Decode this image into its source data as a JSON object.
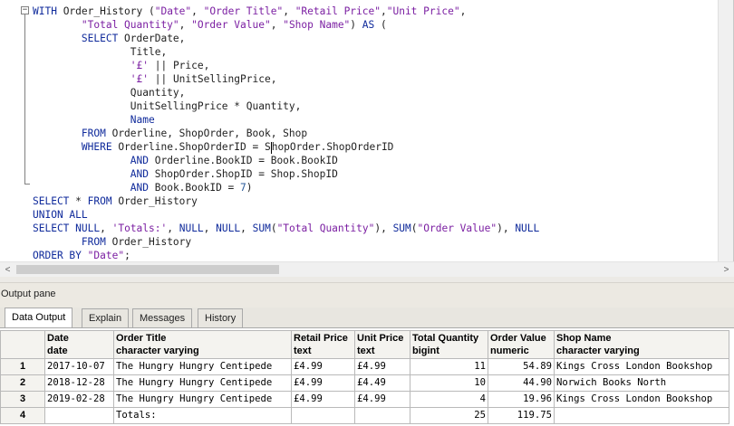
{
  "editor": {
    "fold_symbol": "−",
    "lines": [
      [
        [
          "kw",
          "WITH"
        ],
        [
          "t",
          " Order_History ("
        ],
        [
          "str",
          "\"Date\""
        ],
        [
          "t",
          ", "
        ],
        [
          "str",
          "\"Order Title\""
        ],
        [
          "t",
          ", "
        ],
        [
          "str",
          "\"Retail Price\""
        ],
        [
          "t",
          ","
        ],
        [
          "str",
          "\"Unit Price\""
        ],
        [
          "t",
          ","
        ]
      ],
      [
        [
          "t",
          "        "
        ],
        [
          "str",
          "\"Total Quantity\""
        ],
        [
          "t",
          ", "
        ],
        [
          "str",
          "\"Order Value\""
        ],
        [
          "t",
          ", "
        ],
        [
          "str",
          "\"Shop Name\""
        ],
        [
          "t",
          ") "
        ],
        [
          "kw",
          "AS"
        ],
        [
          "t",
          " ("
        ]
      ],
      [
        [
          "t",
          "        "
        ],
        [
          "kw",
          "SELECT"
        ],
        [
          "t",
          " OrderDate,"
        ]
      ],
      [
        [
          "t",
          "                Title,"
        ]
      ],
      [
        [
          "t",
          "                "
        ],
        [
          "str",
          "'£'"
        ],
        [
          "t",
          " || Price,"
        ]
      ],
      [
        [
          "t",
          "                "
        ],
        [
          "str",
          "'£'"
        ],
        [
          "t",
          " || UnitSellingPrice,"
        ]
      ],
      [
        [
          "t",
          "                Quantity,"
        ]
      ],
      [
        [
          "t",
          "                UnitSellingPrice * Quantity,"
        ]
      ],
      [
        [
          "kw",
          "                Name"
        ]
      ],
      [
        [
          "t",
          "        "
        ],
        [
          "kw",
          "FROM"
        ],
        [
          "t",
          " Orderline, ShopOrder, Book, Shop"
        ]
      ],
      [
        [
          "t",
          "        "
        ],
        [
          "kw",
          "WHERE"
        ],
        [
          "t",
          " Orderline.ShopOrderID = S"
        ],
        [
          "caret",
          ""
        ],
        [
          "t",
          "hopOrder.ShopOrderID"
        ]
      ],
      [
        [
          "t",
          "                "
        ],
        [
          "kw",
          "AND"
        ],
        [
          "t",
          " Orderline.BookID = Book.BookID"
        ]
      ],
      [
        [
          "t",
          "                "
        ],
        [
          "kw",
          "AND"
        ],
        [
          "t",
          " ShopOrder.ShopID = Shop.ShopID"
        ]
      ],
      [
        [
          "t",
          "                "
        ],
        [
          "kw",
          "AND"
        ],
        [
          "t",
          " Book.BookID = "
        ],
        [
          "num",
          "7"
        ],
        [
          "t",
          ")"
        ]
      ],
      [
        [
          "kw",
          "SELECT"
        ],
        [
          "t",
          " * "
        ],
        [
          "kw",
          "FROM"
        ],
        [
          "t",
          " Order_History"
        ]
      ],
      [
        [
          "kw",
          "UNION ALL"
        ]
      ],
      [
        [
          "kw",
          "SELECT"
        ],
        [
          "t",
          " "
        ],
        [
          "kw",
          "NULL"
        ],
        [
          "t",
          ", "
        ],
        [
          "str",
          "'Totals:'"
        ],
        [
          "t",
          ", "
        ],
        [
          "kw",
          "NULL"
        ],
        [
          "t",
          ", "
        ],
        [
          "kw",
          "NULL"
        ],
        [
          "t",
          ", "
        ],
        [
          "kw",
          "SUM"
        ],
        [
          "t",
          "("
        ],
        [
          "str",
          "\"Total Quantity\""
        ],
        [
          "t",
          "), "
        ],
        [
          "kw",
          "SUM"
        ],
        [
          "t",
          "("
        ],
        [
          "str",
          "\"Order Value\""
        ],
        [
          "t",
          "), "
        ],
        [
          "kw",
          "NULL"
        ]
      ],
      [
        [
          "t",
          "        "
        ],
        [
          "kw",
          "FROM"
        ],
        [
          "t",
          " Order_History"
        ]
      ],
      [
        [
          "kw",
          "ORDER BY"
        ],
        [
          "t",
          " "
        ],
        [
          "str",
          "\"Date\""
        ],
        [
          "t",
          ";"
        ]
      ]
    ]
  },
  "scrollbars": {
    "left_arrow": "<",
    "right_arrow": ">"
  },
  "output": {
    "title": "Output pane",
    "tabs": [
      {
        "label": "Data Output",
        "active": true
      },
      {
        "label": "Explain",
        "active": false
      },
      {
        "label": "Messages",
        "active": false
      },
      {
        "label": "History",
        "active": false
      }
    ]
  },
  "grid": {
    "columns": [
      {
        "name": "Date",
        "type": "date"
      },
      {
        "name": "Order Title",
        "type": "character varying"
      },
      {
        "name": "Retail Price",
        "type": "text"
      },
      {
        "name": "Unit Price",
        "type": "text"
      },
      {
        "name": "Total Quantity",
        "type": "bigint"
      },
      {
        "name": "Order Value",
        "type": "numeric"
      },
      {
        "name": "Shop Name",
        "type": "character varying"
      }
    ],
    "rows": [
      {
        "num": "1",
        "cells": [
          "2017-10-07",
          "The Hungry Hungry Centipede",
          "£4.99",
          "£4.99",
          "11",
          "54.89",
          "Kings Cross London Bookshop"
        ]
      },
      {
        "num": "2",
        "cells": [
          "2018-12-28",
          "The Hungry Hungry Centipede",
          "£4.99",
          "£4.49",
          "10",
          "44.90",
          "Norwich Books North"
        ]
      },
      {
        "num": "3",
        "cells": [
          "2019-02-28",
          "The Hungry Hungry Centipede",
          "£4.99",
          "£4.99",
          "4",
          "19.96",
          "Kings Cross London Bookshop"
        ]
      },
      {
        "num": "4",
        "cells": [
          "",
          "Totals:",
          "",
          "",
          "25",
          "119.75",
          ""
        ]
      }
    ]
  }
}
